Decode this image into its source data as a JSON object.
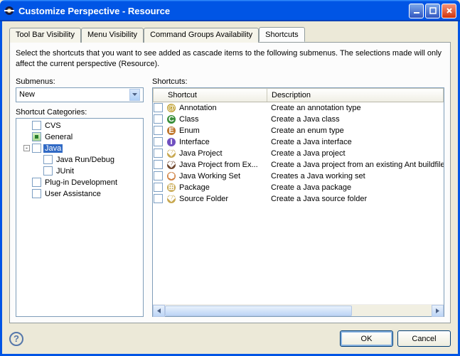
{
  "window": {
    "title": "Customize Perspective - Resource"
  },
  "tabs": [
    {
      "label": "Tool Bar Visibility"
    },
    {
      "label": "Menu Visibility"
    },
    {
      "label": "Command Groups Availability"
    },
    {
      "label": "Shortcuts"
    }
  ],
  "description": "Select the shortcuts that you want to see added as cascade items to the following submenus.  The selections made will only affect the current perspective (Resource).",
  "submenus": {
    "label": "Submenus:",
    "selected": "New"
  },
  "categories": {
    "label": "Shortcut Categories:",
    "items": [
      {
        "label": "CVS",
        "depth": 1,
        "state": "unchecked"
      },
      {
        "label": "General",
        "depth": 1,
        "state": "tri"
      },
      {
        "label": "Java",
        "depth": 1,
        "state": "unchecked",
        "selected": true,
        "expander": "-"
      },
      {
        "label": "Java Run/Debug",
        "depth": 2,
        "state": "unchecked"
      },
      {
        "label": "JUnit",
        "depth": 2,
        "state": "unchecked"
      },
      {
        "label": "Plug-in Development",
        "depth": 1,
        "state": "unchecked"
      },
      {
        "label": "User Assistance",
        "depth": 1,
        "state": "unchecked"
      }
    ]
  },
  "shortcuts": {
    "label": "Shortcuts:",
    "cols": {
      "shortcut": "Shortcut",
      "description": "Description"
    },
    "items": [
      {
        "icon": "annotation-icon",
        "color": "#c0a030",
        "glyph": "@",
        "name": "Annotation",
        "desc": "Create an annotation type"
      },
      {
        "icon": "class-icon",
        "color": "#3a8f3a",
        "glyph": "C",
        "name": "Class",
        "desc": "Create a Java class"
      },
      {
        "icon": "enum-icon",
        "color": "#c07830",
        "glyph": "E",
        "name": "Enum",
        "desc": "Create an enum type"
      },
      {
        "icon": "interface-icon",
        "color": "#7050c0",
        "glyph": "I",
        "name": "Interface",
        "desc": "Create a Java interface"
      },
      {
        "icon": "project-icon",
        "color": "#c8a850",
        "glyph": "📁",
        "name": "Java Project",
        "desc": "Create a Java project"
      },
      {
        "icon": "ant-project-icon",
        "color": "#704830",
        "glyph": "🐜",
        "name": "Java Project from Ex...",
        "desc": "Create a Java project from an existing Ant buildfile or"
      },
      {
        "icon": "workingset-icon",
        "color": "#d08040",
        "glyph": "⬢",
        "name": "Java Working Set",
        "desc": "Creates a Java working set"
      },
      {
        "icon": "package-icon",
        "color": "#c8a850",
        "glyph": "⊞",
        "name": "Package",
        "desc": "Create a Java package"
      },
      {
        "icon": "srcfolder-icon",
        "color": "#c8a850",
        "glyph": "📂",
        "name": "Source Folder",
        "desc": "Create a Java source folder"
      }
    ]
  },
  "buttons": {
    "ok": "OK",
    "cancel": "Cancel"
  }
}
